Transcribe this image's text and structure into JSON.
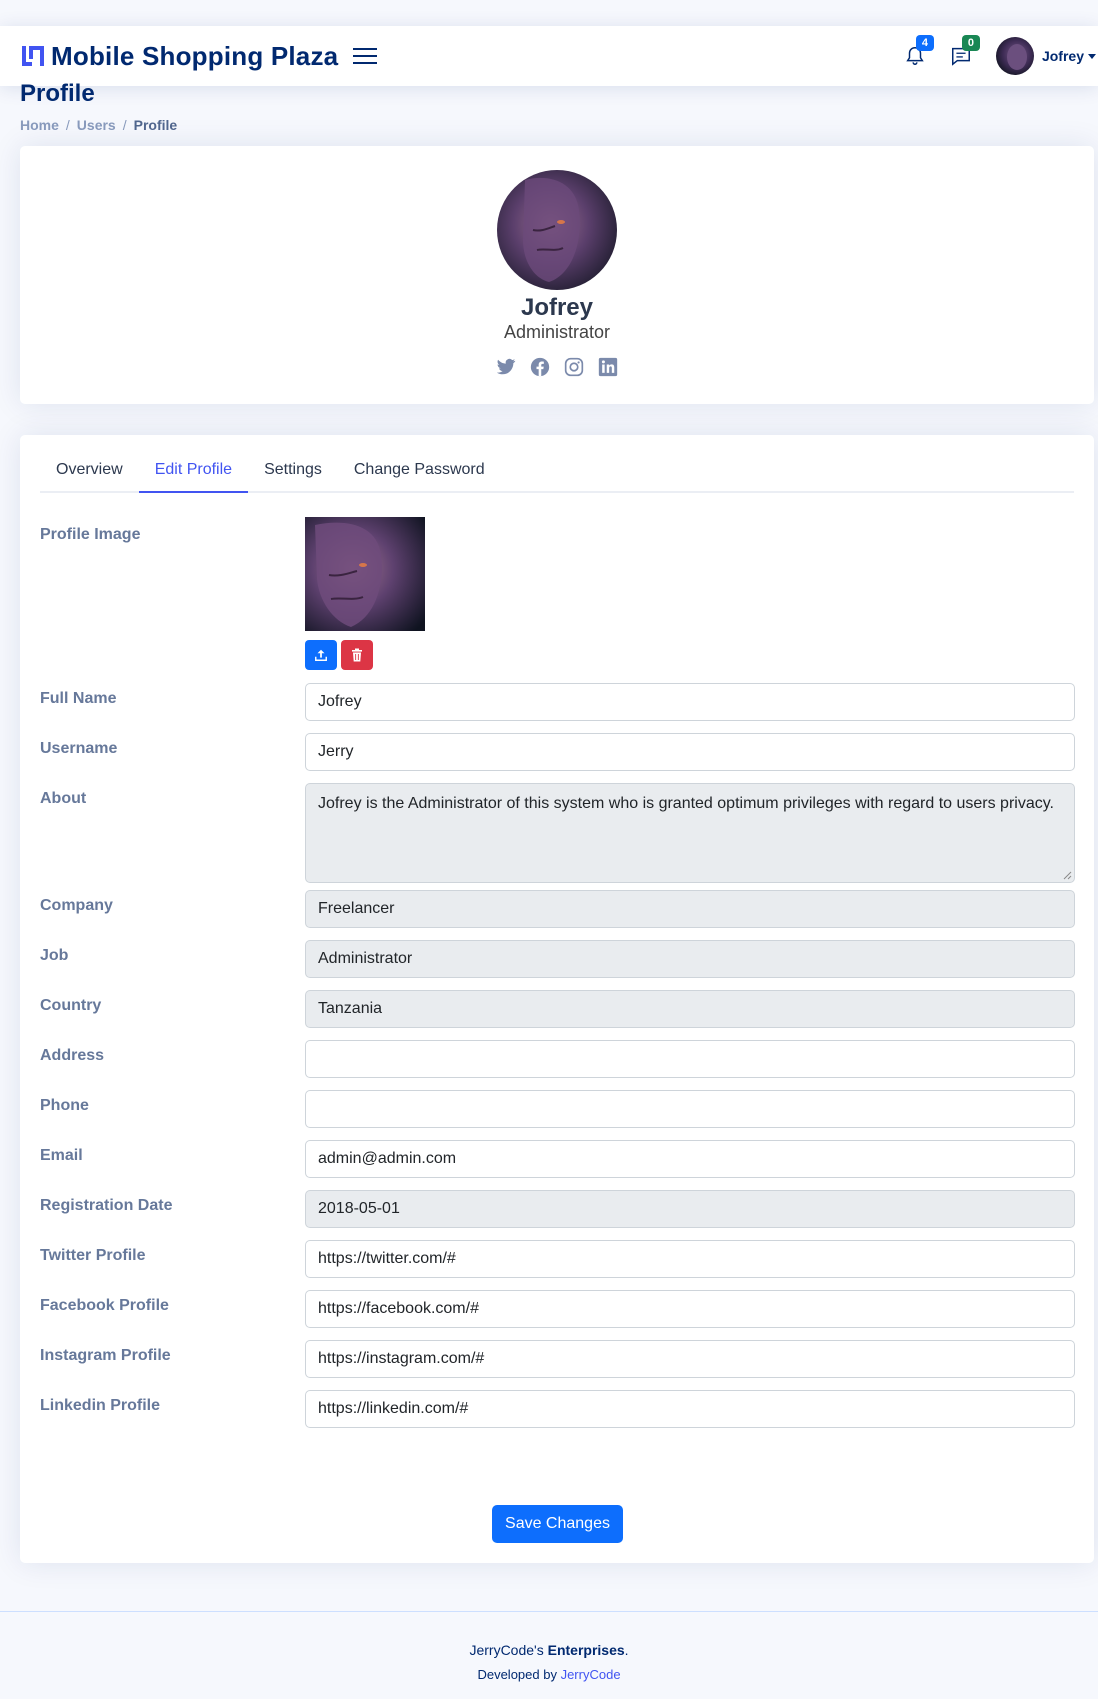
{
  "header": {
    "brand": "Mobile Shopping Plaza",
    "notifications_count": "4",
    "messages_count": "0",
    "user_name": "Jofrey"
  },
  "page": {
    "title": "Profile",
    "breadcrumb": [
      "Home",
      "Users",
      "Profile"
    ]
  },
  "profile_card": {
    "name": "Jofrey",
    "role": "Administrator",
    "social": [
      "twitter-icon",
      "facebook-icon",
      "instagram-icon",
      "linkedin-icon"
    ]
  },
  "tabs": [
    {
      "label": "Overview",
      "active": false
    },
    {
      "label": "Edit Profile",
      "active": true
    },
    {
      "label": "Settings",
      "active": false
    },
    {
      "label": "Change Password",
      "active": false
    }
  ],
  "form": {
    "profile_image_label": "Profile Image",
    "fields": [
      {
        "label": "Full Name",
        "value": "Jofrey",
        "readonly": false
      },
      {
        "label": "Username",
        "value": "Jerry",
        "readonly": false
      },
      {
        "label": "About",
        "value": "Jofrey is the Administrator of this system who is granted optimum privileges with regard to users privacy.",
        "readonly": true
      },
      {
        "label": "Company",
        "value": "Freelancer",
        "readonly": true
      },
      {
        "label": "Job",
        "value": "Administrator",
        "readonly": true
      },
      {
        "label": "Country",
        "value": "Tanzania",
        "readonly": true
      },
      {
        "label": "Address",
        "value": "",
        "readonly": false
      },
      {
        "label": "Phone",
        "value": "",
        "readonly": false
      },
      {
        "label": "Email",
        "value": "admin@admin.com",
        "readonly": false
      },
      {
        "label": "Registration Date",
        "value": "2018-05-01",
        "readonly": true
      },
      {
        "label": "Twitter Profile",
        "value": "https://twitter.com/#",
        "readonly": false
      },
      {
        "label": "Facebook Profile",
        "value": "https://facebook.com/#",
        "readonly": false
      },
      {
        "label": "Instagram Profile",
        "value": "https://instagram.com/#",
        "readonly": false
      },
      {
        "label": "Linkedin Profile",
        "value": "https://linkedin.com/#",
        "readonly": false
      }
    ],
    "save_label": "Save Changes"
  },
  "footer": {
    "copy_prefix": "JerryCode's ",
    "copy_bold": "Enterprises",
    "copy_suffix": ".",
    "credits_prefix": "Developed by ",
    "credits_link": "JerryCode"
  },
  "colors": {
    "brand": "#012970",
    "accent": "#4154f1",
    "primary": "#0d6efd",
    "danger": "#dc3545",
    "success": "#198754"
  }
}
